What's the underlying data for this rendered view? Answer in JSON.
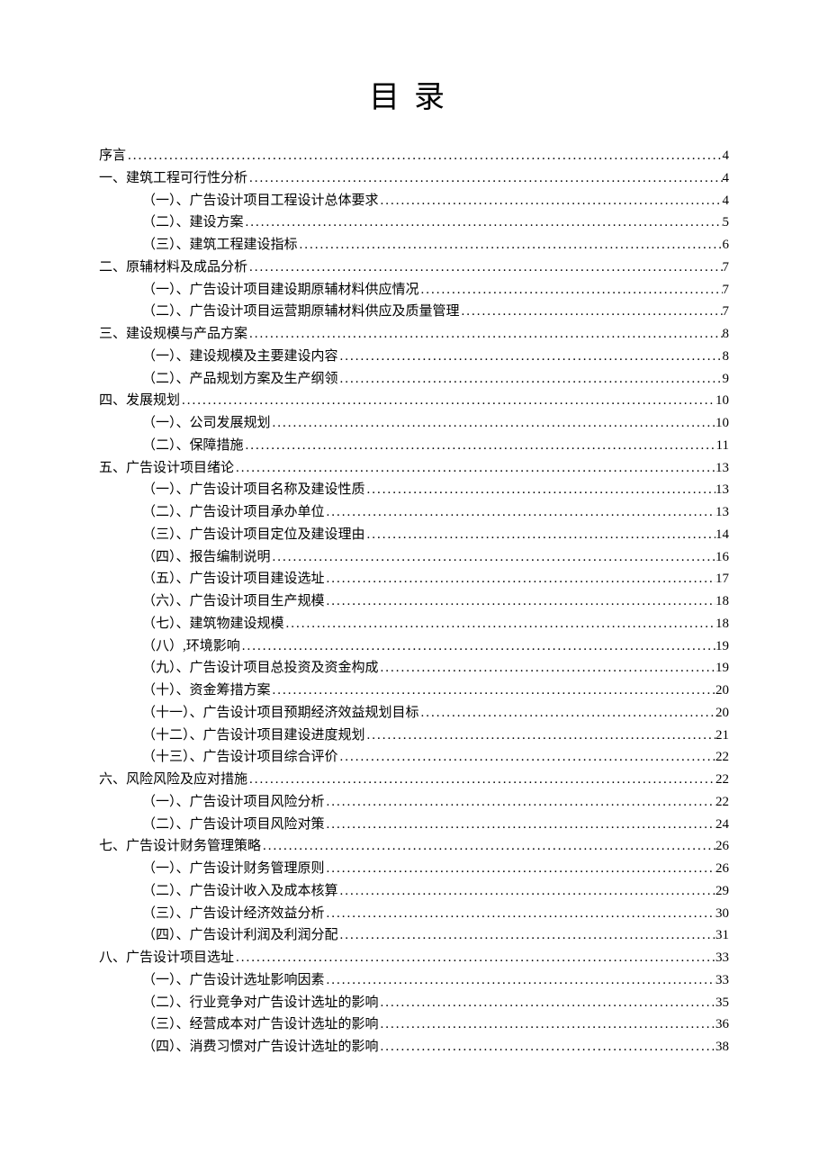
{
  "title": "目录",
  "entries": [
    {
      "level": 1,
      "text": "序言",
      "page": "4"
    },
    {
      "level": 1,
      "text": "一、建筑工程可行性分析",
      "page": "4"
    },
    {
      "level": 2,
      "text": "（一）、广告设计项目工程设计总体要求",
      "page": "4"
    },
    {
      "level": 2,
      "text": "（二）、建设方案",
      "page": "5"
    },
    {
      "level": 2,
      "text": "（三）、建筑工程建设指标",
      "page": "6"
    },
    {
      "level": 1,
      "text": "二、原辅材料及成品分析",
      "page": "7"
    },
    {
      "level": 2,
      "text": "（一）、广告设计项目建设期原辅材料供应情况",
      "page": "7"
    },
    {
      "level": 2,
      "text": "（二）、广告设计项目运营期原辅材料供应及质量管理",
      "page": "7"
    },
    {
      "level": 1,
      "text": "三、建设规模与产品方案",
      "page": "8"
    },
    {
      "level": 2,
      "text": "（一）、建设规模及主要建设内容",
      "page": "8"
    },
    {
      "level": 2,
      "text": "（二）、产品规划方案及生产纲领",
      "page": "9"
    },
    {
      "level": 1,
      "text": "四、发展规划",
      "page": "10"
    },
    {
      "level": 2,
      "text": "（一）、公司发展规划",
      "page": "10"
    },
    {
      "level": 2,
      "text": "（二）、保障措施",
      "page": "11"
    },
    {
      "level": 1,
      "text": "五、广告设计项目绪论",
      "page": "13"
    },
    {
      "level": 2,
      "text": "（一）、广告设计项目名称及建设性质",
      "page": "13"
    },
    {
      "level": 2,
      "text": "（二）、广告设计项目承办单位",
      "page": "13"
    },
    {
      "level": 2,
      "text": "（三）、广告设计项目定位及建设理由",
      "page": "14"
    },
    {
      "level": 2,
      "text": "（四）、报告编制说明",
      "page": "16"
    },
    {
      "level": 2,
      "text": "（五）、广告设计项目建设选址",
      "page": "17"
    },
    {
      "level": 2,
      "text": "（六）、广告设计项目生产规模",
      "page": "18"
    },
    {
      "level": 2,
      "text": "（七）、建筑物建设规模",
      "page": "18"
    },
    {
      "level": 2,
      "text": "（八）,环境影响",
      "page": "19"
    },
    {
      "level": 2,
      "text": "（九）、广告设计项目总投资及资金构成",
      "page": "19"
    },
    {
      "level": 2,
      "text": "（十）、资金筹措方案",
      "page": "20"
    },
    {
      "level": 2,
      "text": "（十一）、广告设计项目预期经济效益规划目标",
      "page": "20"
    },
    {
      "level": 2,
      "text": "（十二）、广告设计项目建设进度规划",
      "page": "21"
    },
    {
      "level": 2,
      "text": "（十三）、广告设计项目综合评价",
      "page": "22"
    },
    {
      "level": 1,
      "text": "六、风险风险及应对措施",
      "page": "22"
    },
    {
      "level": 2,
      "text": "（一）、广告设计项目风险分析",
      "page": "22"
    },
    {
      "level": 2,
      "text": "（二）、广告设计项目风险对策",
      "page": "24"
    },
    {
      "level": 1,
      "text": "七、广告设计财务管理策略",
      "page": "26"
    },
    {
      "level": 2,
      "text": "（一）、广告设计财务管理原则",
      "page": "26"
    },
    {
      "level": 2,
      "text": "（二）、广告设计收入及成本核算",
      "page": "29"
    },
    {
      "level": 2,
      "text": "（三）、广告设计经济效益分析",
      "page": "30"
    },
    {
      "level": 2,
      "text": "（四）、广告设计利润及利润分配",
      "page": "31"
    },
    {
      "level": 1,
      "text": "八、广告设计项目选址",
      "page": "33"
    },
    {
      "level": 2,
      "text": "（一）、广告设计选址影响因素",
      "page": "33"
    },
    {
      "level": 2,
      "text": "（二）、行业竞争对广告设计选址的影响",
      "page": "35"
    },
    {
      "level": 2,
      "text": "（三）、经营成本对广告设计选址的影响",
      "page": "36"
    },
    {
      "level": 2,
      "text": "（四）、消费习惯对广告设计选址的影响",
      "page": "38"
    }
  ]
}
